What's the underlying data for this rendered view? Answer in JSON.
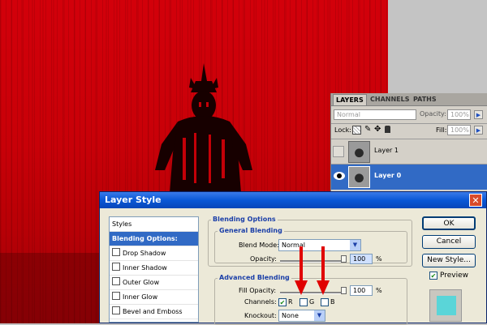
{
  "layers_panel": {
    "tabs": [
      "LAYERS",
      "CHANNELS",
      "PATHS"
    ],
    "blend_mode": "Normal",
    "opacity_label": "Opacity:",
    "opacity_value": "100%",
    "lock_label": "Lock:",
    "fill_label": "Fill:",
    "fill_value": "100%",
    "layers": [
      {
        "name": "Layer 1",
        "selected": false
      },
      {
        "name": "Layer 0",
        "selected": true
      }
    ]
  },
  "dialog": {
    "title": "Layer Style",
    "styles_header": "Styles",
    "styles": [
      {
        "label": "Blending Options: Custom",
        "selected": true
      },
      {
        "label": "Drop Shadow"
      },
      {
        "label": "Inner Shadow"
      },
      {
        "label": "Outer Glow"
      },
      {
        "label": "Inner Glow"
      },
      {
        "label": "Bevel and Emboss"
      }
    ],
    "blending_options": {
      "heading": "Blending Options",
      "general_heading": "General Blending",
      "blend_mode_label": "Blend Mode:",
      "blend_mode_value": "Normal",
      "opacity_label": "Opacity:",
      "opacity_value": "100",
      "percent": "%"
    },
    "advanced": {
      "heading": "Advanced Blending",
      "fill_opacity_label": "Fill Opacity:",
      "fill_opacity_value": "100",
      "percent": "%",
      "channels_label": "Channels:",
      "channels": [
        {
          "label": "R",
          "checked": true
        },
        {
          "label": "G",
          "checked": false
        },
        {
          "label": "B",
          "checked": false
        }
      ],
      "knockout_label": "Knockout:",
      "knockout_value": "None"
    },
    "buttons": {
      "ok": "OK",
      "cancel": "Cancel",
      "new_style": "New Style...",
      "preview": "Preview"
    },
    "preview_checked": true,
    "preview_swatch_color": "#5ad5d8"
  },
  "colors": {
    "canvas_red": "#cc0008",
    "selection_blue": "#316ac5",
    "arrow_red": "#e00000"
  }
}
